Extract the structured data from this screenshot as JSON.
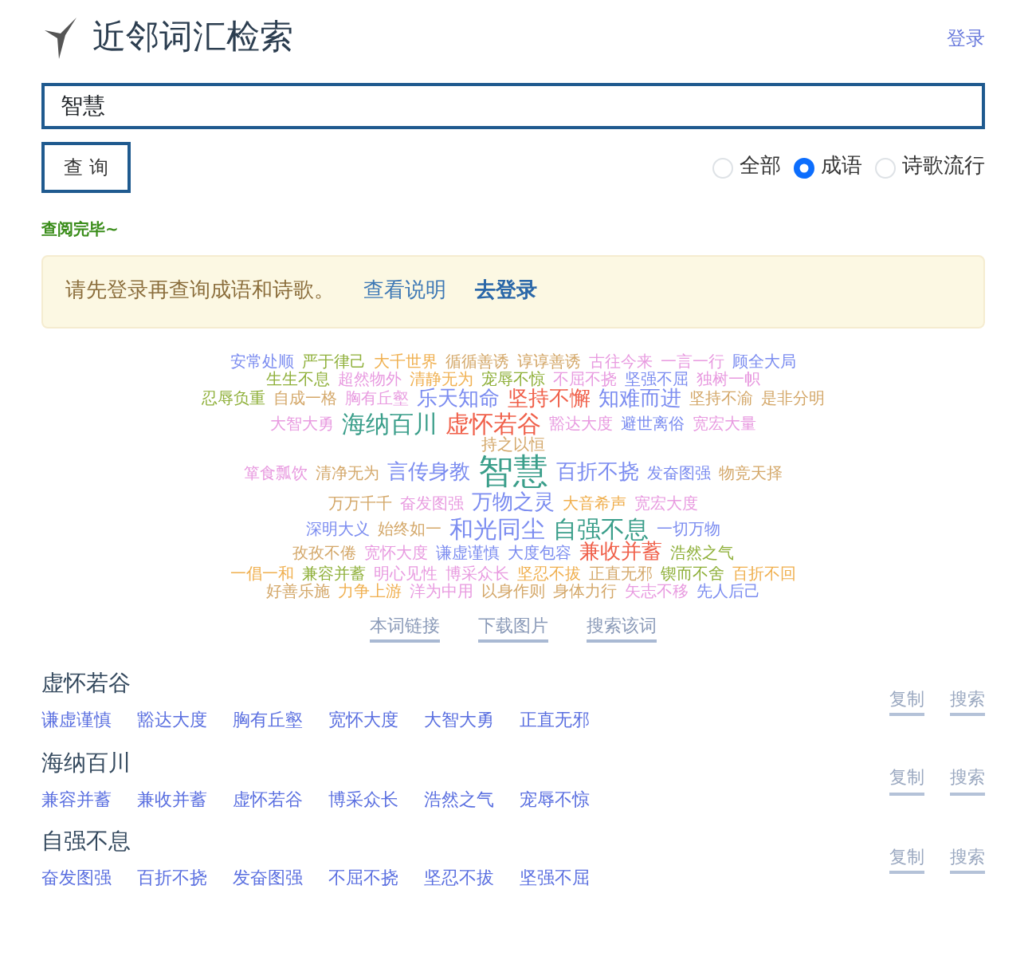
{
  "header": {
    "title": "近邻词汇检索",
    "login_link": "登录"
  },
  "search": {
    "value": "智慧",
    "button": "查 询"
  },
  "scope_options": [
    {
      "label": "全部",
      "selected": false
    },
    {
      "label": "成语",
      "selected": true
    },
    {
      "label": "诗歌流行",
      "selected": false
    }
  ],
  "status": "查阅完毕~",
  "notice": {
    "text": "请先登录再查询成语和诗歌。",
    "links": [
      "查看说明",
      "去登录"
    ]
  },
  "word_cloud": [
    [
      {
        "text": "安常处顺",
        "color": "#7b8cf0",
        "kind": "small"
      },
      {
        "text": "严于律己",
        "color": "#8fb03a",
        "kind": "small"
      },
      {
        "text": "大千世界",
        "color": "#f0b050",
        "kind": "small"
      },
      {
        "text": "循循善诱",
        "color": "#d4a86a",
        "kind": "small"
      },
      {
        "text": "谆谆善诱",
        "color": "#d4a86a",
        "kind": "small"
      },
      {
        "text": "古往今来",
        "color": "#e89be0",
        "kind": "small"
      },
      {
        "text": "一言一行",
        "color": "#e89be0",
        "kind": "small"
      },
      {
        "text": "顾全大局",
        "color": "#7b8cf0",
        "kind": "small"
      }
    ],
    [
      {
        "text": "生生不息",
        "color": "#8fb03a",
        "kind": "small"
      },
      {
        "text": "超然物外",
        "color": "#e89be0",
        "kind": "small"
      },
      {
        "text": "清静无为",
        "color": "#f0b050",
        "kind": "small"
      },
      {
        "text": "宠辱不惊",
        "color": "#8fb03a",
        "kind": "small"
      },
      {
        "text": "不屈不挠",
        "color": "#e89be0",
        "kind": "small"
      },
      {
        "text": "坚强不屈",
        "color": "#7b8cf0",
        "kind": "small"
      },
      {
        "text": "独树一帜",
        "color": "#e89be0",
        "kind": "small"
      }
    ],
    [
      {
        "text": "忍辱负重",
        "color": "#8fb03a",
        "kind": "small"
      },
      {
        "text": "自成一格",
        "color": "#d4a86a",
        "kind": "small"
      },
      {
        "text": "胸有丘壑",
        "color": "#e89be0",
        "kind": "small"
      },
      {
        "text": "乐天知命",
        "color": "#7b8cf0",
        "kind": "mid"
      },
      {
        "text": "坚持不懈",
        "color": "#f0604a",
        "kind": "mid"
      },
      {
        "text": "知难而进",
        "color": "#7b8cf0",
        "kind": "mid"
      },
      {
        "text": "坚持不渝",
        "color": "#d4a86a",
        "kind": "small"
      },
      {
        "text": "是非分明",
        "color": "#d4a86a",
        "kind": "small"
      }
    ],
    [
      {
        "text": "大智大勇",
        "color": "#e89be0",
        "kind": "small"
      },
      {
        "text": "海纳百川",
        "color": "#3a9e8a",
        "kind": "big"
      },
      {
        "text": "虚怀若谷",
        "color": "#f0604a",
        "kind": "big"
      },
      {
        "text": "豁达大度",
        "color": "#e89be0",
        "kind": "small"
      },
      {
        "text": "避世离俗",
        "color": "#7b8cf0",
        "kind": "small"
      },
      {
        "text": "宽宏大量",
        "color": "#e89be0",
        "kind": "small"
      }
    ],
    [
      {
        "text": "持之以恒",
        "color": "#d4a86a",
        "kind": "small"
      }
    ],
    [
      {
        "text": "箪食瓢饮",
        "color": "#e89be0",
        "kind": "small"
      },
      {
        "text": "清净无为",
        "color": "#d4a86a",
        "kind": "small"
      },
      {
        "text": "言传身教",
        "color": "#7b8cf0",
        "kind": "mid"
      },
      {
        "text": "智慧",
        "color": "#3a9e8a",
        "kind": "huge"
      },
      {
        "text": "百折不挠",
        "color": "#7b8cf0",
        "kind": "mid"
      },
      {
        "text": "发奋图强",
        "color": "#7b8cf0",
        "kind": "small"
      },
      {
        "text": "物竞天择",
        "color": "#d4a86a",
        "kind": "small"
      }
    ],
    [
      {
        "text": "万万千千",
        "color": "#d4a86a",
        "kind": "small"
      },
      {
        "text": "奋发图强",
        "color": "#e89be0",
        "kind": "small"
      },
      {
        "text": "万物之灵",
        "color": "#7b8cf0",
        "kind": "mid"
      },
      {
        "text": "大音希声",
        "color": "#f0b050",
        "kind": "small"
      },
      {
        "text": "宽宏大度",
        "color": "#e89be0",
        "kind": "small"
      }
    ],
    [
      {
        "text": "深明大义",
        "color": "#7b8cf0",
        "kind": "small"
      },
      {
        "text": "始终如一",
        "color": "#d4a86a",
        "kind": "small"
      },
      {
        "text": "和光同尘",
        "color": "#7b8cf0",
        "kind": "big"
      },
      {
        "text": "自强不息",
        "color": "#3a9e8a",
        "kind": "big"
      },
      {
        "text": "一切万物",
        "color": "#7b8cf0",
        "kind": "small"
      }
    ],
    [
      {
        "text": "孜孜不倦",
        "color": "#d4a86a",
        "kind": "small"
      },
      {
        "text": "宽怀大度",
        "color": "#e89be0",
        "kind": "small"
      },
      {
        "text": "谦虚谨慎",
        "color": "#7b8cf0",
        "kind": "small"
      },
      {
        "text": "大度包容",
        "color": "#7b8cf0",
        "kind": "small"
      },
      {
        "text": "兼收并蓄",
        "color": "#f0604a",
        "kind": "mid"
      },
      {
        "text": "浩然之气",
        "color": "#8fb03a",
        "kind": "small"
      }
    ],
    [
      {
        "text": "一倡一和",
        "color": "#f0b050",
        "kind": "small"
      },
      {
        "text": "兼容并蓄",
        "color": "#8fb03a",
        "kind": "small"
      },
      {
        "text": "明心见性",
        "color": "#e89be0",
        "kind": "small"
      },
      {
        "text": "博采众长",
        "color": "#e89be0",
        "kind": "small"
      },
      {
        "text": "坚忍不拔",
        "color": "#f0b050",
        "kind": "small"
      },
      {
        "text": "正直无邪",
        "color": "#d4a86a",
        "kind": "small"
      },
      {
        "text": "锲而不舍",
        "color": "#8fb03a",
        "kind": "small"
      },
      {
        "text": "百折不回",
        "color": "#f0b050",
        "kind": "small"
      }
    ],
    [
      {
        "text": "好善乐施",
        "color": "#d4a86a",
        "kind": "small"
      },
      {
        "text": "力争上游",
        "color": "#f0b050",
        "kind": "small"
      },
      {
        "text": "洋为中用",
        "color": "#e89be0",
        "kind": "small"
      },
      {
        "text": "以身作则",
        "color": "#d4a86a",
        "kind": "small"
      },
      {
        "text": "身体力行",
        "color": "#d4a86a",
        "kind": "small"
      },
      {
        "text": "矢志不移",
        "color": "#e89be0",
        "kind": "small"
      },
      {
        "text": "先人后己",
        "color": "#7b8cf0",
        "kind": "small"
      }
    ]
  ],
  "cloud_links": [
    "本词链接",
    "下载图片",
    "搜索该词"
  ],
  "results": [
    {
      "word": "虚怀若谷",
      "related": [
        "谦虚谨慎",
        "豁达大度",
        "胸有丘壑",
        "宽怀大度",
        "大智大勇",
        "正直无邪"
      ],
      "actions": [
        "复制",
        "搜索"
      ]
    },
    {
      "word": "海纳百川",
      "related": [
        "兼容并蓄",
        "兼收并蓄",
        "虚怀若谷",
        "博采众长",
        "浩然之气",
        "宠辱不惊"
      ],
      "actions": [
        "复制",
        "搜索"
      ]
    },
    {
      "word": "自强不息",
      "related": [
        "奋发图强",
        "百折不挠",
        "发奋图强",
        "不屈不挠",
        "坚忍不拔",
        "坚强不屈"
      ],
      "actions": [
        "复制",
        "搜索"
      ]
    }
  ]
}
